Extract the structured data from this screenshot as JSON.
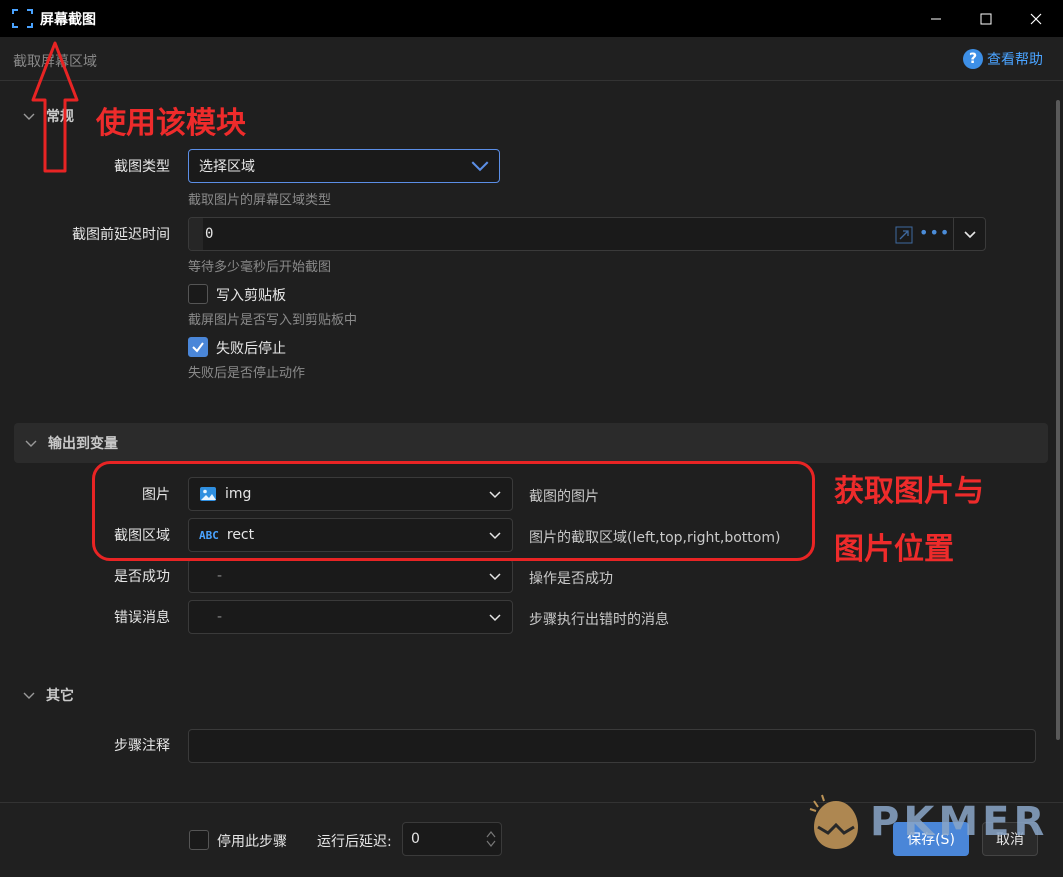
{
  "window": {
    "title": "屏幕截图",
    "controls": [
      "minimize-icon",
      "maximize-icon",
      "close-icon"
    ]
  },
  "header": {
    "subtitle": "截取屏幕区域",
    "help_label": "查看帮助",
    "help_icon": "question-circle-icon"
  },
  "sections": {
    "general": {
      "title": "常规",
      "capture_type": {
        "label": "截图类型",
        "value": "选择区域",
        "hint": "截取图片的屏幕区域类型"
      },
      "delay": {
        "label": "截图前延迟时间",
        "value": "0",
        "hint": "等待多少毫秒后开始截图"
      },
      "clipboard": {
        "label": "写入剪贴板",
        "checked": false,
        "hint": "截屏图片是否写入到剪贴板中"
      },
      "stop_on_fail": {
        "label": "失败后停止",
        "checked": true,
        "hint": "失败后是否停止动作"
      }
    },
    "output": {
      "title": "输出到变量",
      "rows": [
        {
          "label": "图片",
          "value": "img",
          "icon": "image-icon",
          "desc": "截图的图片"
        },
        {
          "label": "截图区域",
          "value": "rect",
          "icon": "abc-text-icon",
          "desc": "图片的截取区域(left,top,right,bottom)"
        },
        {
          "label": "是否成功",
          "value": "-",
          "icon": "",
          "desc": "操作是否成功"
        },
        {
          "label": "错误消息",
          "value": "-",
          "icon": "",
          "desc": "步骤执行出错时的消息"
        }
      ]
    },
    "other": {
      "title": "其它",
      "note": {
        "label": "步骤注释",
        "value": ""
      }
    }
  },
  "footer": {
    "disable_label": "停用此步骤",
    "disable_checked": false,
    "run_delay_label": "运行后延迟:",
    "run_delay_value": "0",
    "save_label": "保存(S)",
    "cancel_label": "取消"
  },
  "annotations": {
    "use_module": "使用该模块",
    "get_image_line1": "获取图片与",
    "get_image_line2": "图片位置"
  },
  "watermark": {
    "text": "PKMER"
  },
  "colors": {
    "accent": "#4a86d8",
    "annotation": "#ee2b2b",
    "background": "#1f1f1f",
    "titlebar": "#000000"
  }
}
